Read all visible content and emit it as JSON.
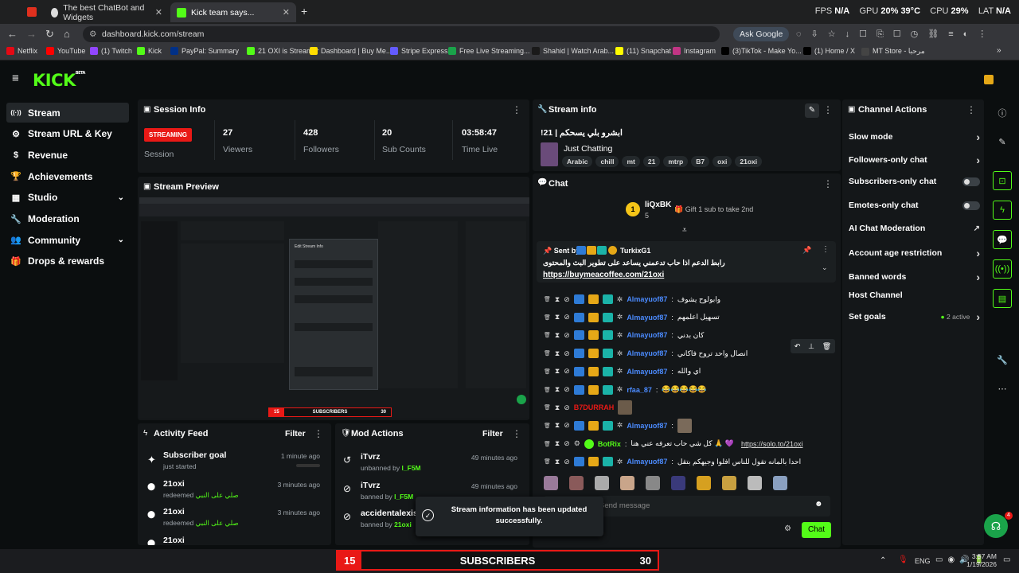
{
  "browser": {
    "tabs": [
      {
        "title": "The best ChatBot and Widgets"
      },
      {
        "title": "Kick team says..."
      }
    ],
    "url": "dashboard.kick.com/stream",
    "ask_google": "Ask Google",
    "perf": {
      "fps_label": "FPS",
      "fps": "N/A",
      "gpu_label": "GPU",
      "gpu": "20%",
      "gpu_temp": "39°C",
      "cpu_label": "CPU",
      "cpu": "29%",
      "lat_label": "LAT",
      "lat": "N/A"
    },
    "bookmarks": [
      "Netflix",
      "YouTube",
      "(1) Twitch",
      "Kick",
      "PayPal: Summary",
      "21 OXI is Streamer",
      "Dashboard | Buy Me...",
      "Stripe Express",
      "Free Live Streaming...",
      "Shahid | Watch Arab...",
      "(11) Snapchat",
      "Instagram",
      "(3)TikTok - Make Yo...",
      "(1) Home / X",
      "MT Store - مرحبا"
    ],
    "bookmark_colors": [
      "#e50914",
      "#ff0000",
      "#9146ff",
      "#53fc18",
      "#003087",
      "#53fc18",
      "#ffdd00",
      "#635bff",
      "#1aa34a",
      "#1a1a1a",
      "#fffc00",
      "#c13584",
      "#000000",
      "#000000",
      "#444444"
    ]
  },
  "app": {
    "logo": "KICK",
    "logo_sup": "BETA"
  },
  "sidebar": {
    "items": [
      {
        "label": "Stream",
        "icon": "signal-icon"
      },
      {
        "label": "Stream URL & Key",
        "icon": "gear-icon"
      },
      {
        "label": "Revenue",
        "icon": "dollar-icon"
      },
      {
        "label": "Achievements",
        "icon": "trophy-icon"
      },
      {
        "label": "Studio",
        "icon": "layout-icon"
      },
      {
        "label": "Moderation",
        "icon": "wrench-icon"
      },
      {
        "label": "Community",
        "icon": "users-icon"
      },
      {
        "label": "Drops & rewards",
        "icon": "gift-icon"
      }
    ]
  },
  "session": {
    "title": "Session Info",
    "status": "STREAMING",
    "status_label": "Session",
    "stats": [
      {
        "value": "27",
        "label": "Viewers"
      },
      {
        "value": "428",
        "label": "Followers"
      },
      {
        "value": "20",
        "label": "Sub Counts"
      },
      {
        "value": "03:58:47",
        "label": "Time Live"
      }
    ]
  },
  "preview": {
    "title": "Stream Preview",
    "modal_title": "Edit Stream Info",
    "overlay_left": "15",
    "overlay_mid": "SUBSCRIBERS",
    "overlay_right": "30"
  },
  "stream_info": {
    "title": "Stream info",
    "stream_title": "!21 | ابشرو بلي يسحكم",
    "category": "Just Chatting",
    "tags": [
      "Arabic",
      "chill",
      "mt",
      "21",
      "mtrp",
      "B7",
      "oxi",
      "21oxi"
    ]
  },
  "chat": {
    "title": "Chat",
    "top_gifter": "liQxBK",
    "top_gifter_count": "5",
    "gift_rank": "1",
    "gift_prompt": "Gift 1 sub to take 2nd",
    "pinned": {
      "sent_by": "Sent by",
      "user": "TurkixG1",
      "message": "رابط الدعم اذا حاب تدعمني يساعد على تطوير البث والمحتوى",
      "link": "https://buymeacoffee.com/21oxi"
    },
    "messages": [
      {
        "user": "Almayuof87",
        "text": "وابولوح يشوف"
      },
      {
        "user": "Almayuof87",
        "text": "تسهيل اعلمهم"
      },
      {
        "user": "Almayuof87",
        "text": "كان بدني"
      },
      {
        "user": "Almayuof87",
        "text": "انصال واحد تروح فاكاني"
      },
      {
        "user": "Almayuof87",
        "text": "اي والله"
      },
      {
        "user": "rfaa_87",
        "text": "😂😂😂😂😂"
      },
      {
        "user": "B7DURRAH",
        "text": ""
      },
      {
        "user": "Almayuof87",
        "text": ""
      },
      {
        "user": "BotRix",
        "text": "كل شي حاب تعرفه عني هنا 🙏 💜",
        "link": "https://solo.to/21oxi"
      },
      {
        "user": "Almayuof87",
        "text": "احدا بالمانه تقول للناس افلوا وجيهكم بتقل"
      }
    ],
    "input_placeholder": "Send message",
    "send_button": "Chat"
  },
  "channel_actions": {
    "title": "Channel Actions",
    "items": [
      {
        "label": "Slow mode",
        "control": "chevron"
      },
      {
        "label": "Followers-only chat",
        "control": "chevron"
      },
      {
        "label": "Subscribers-only chat",
        "control": "toggle"
      },
      {
        "label": "Emotes-only chat",
        "control": "toggle"
      },
      {
        "label": "AI Chat Moderation",
        "control": "external"
      },
      {
        "label": "Account age restriction",
        "control": "chevron"
      },
      {
        "label": "Banned words",
        "control": "chevron"
      },
      {
        "label": "Host Channel",
        "control": "none"
      },
      {
        "label": "Set goals",
        "control": "chevron",
        "status": "2 active"
      }
    ]
  },
  "activity": {
    "title": "Activity Feed",
    "filter": "Filter",
    "items": [
      {
        "title": "Subscriber goal",
        "sub": "just started",
        "time": "1 minute ago"
      },
      {
        "title": "21oxi",
        "sub": "redeemed",
        "reward": "صلي على النبي",
        "time": "3 minutes ago"
      },
      {
        "title": "21oxi",
        "sub": "redeemed",
        "reward": "صلي على النبي",
        "time": "3 minutes ago"
      },
      {
        "title": "21oxi"
      }
    ]
  },
  "mod_actions": {
    "title": "Mod Actions",
    "filter": "Filter",
    "items": [
      {
        "title": "iTvrz",
        "action": "unbanned by",
        "by": "l_F5M",
        "time": "49 minutes ago"
      },
      {
        "title": "iTvrz",
        "action": "banned by",
        "by": "l_F5M",
        "time": "49 minutes ago"
      },
      {
        "title": "accidentalexist",
        "action": "banned by",
        "by": "21oxi",
        "time": "49 minutes ago"
      }
    ]
  },
  "toast": {
    "line1": "Stream information has been updated",
    "line2": "successfully."
  },
  "overlay": {
    "left": "15",
    "mid": "SUBSCRIBERS",
    "right": "30"
  },
  "taskbar": {
    "lang": "ENG",
    "time": "3:57 AM",
    "date": "1/19/2026"
  },
  "support_badge": "4",
  "colors": {
    "accent": "#53fc18",
    "live": "#e91916",
    "username": "#4b8bff",
    "panel": "#141719"
  }
}
